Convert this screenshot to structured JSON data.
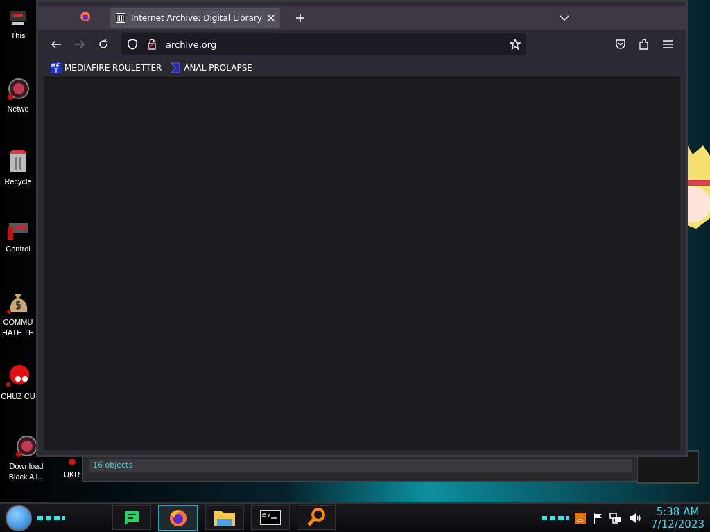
{
  "desktop_icons": [
    {
      "label": "This",
      "kind": "computer"
    },
    {
      "label": "Netwo",
      "kind": "orb"
    },
    {
      "label": "Recycle",
      "kind": "bin"
    },
    {
      "label": "Control",
      "kind": "panel"
    },
    {
      "label": "COMMU HATE TH",
      "kind": "money"
    },
    {
      "label": "CHUZ CU",
      "kind": "creature"
    },
    {
      "label": "Download Black Ali...",
      "kind": "orb"
    }
  ],
  "behind_window": {
    "icon_label": "UKR",
    "status": "16 objects"
  },
  "browser": {
    "tabs": [
      {
        "title": "Internet Archive: Digital Library",
        "selected": true
      }
    ],
    "address": "archive.org",
    "bookmarks": [
      {
        "label": "MEDIAFIRE ROULETTER",
        "kind": "mft"
      },
      {
        "label": "ANAL PROLAPSE",
        "kind": "sigma"
      }
    ]
  },
  "taskbar": {
    "apps": [
      {
        "kind": "chat",
        "active": false
      },
      {
        "kind": "firefox",
        "active": true
      },
      {
        "kind": "folder",
        "active": false
      },
      {
        "kind": "terminal",
        "active": false
      },
      {
        "kind": "magnifier",
        "active": false
      }
    ],
    "tray": [
      {
        "kind": "java"
      },
      {
        "kind": "flag"
      },
      {
        "kind": "network"
      },
      {
        "kind": "volume"
      }
    ],
    "time": "5:38 AM",
    "date": "7/12/2023"
  }
}
